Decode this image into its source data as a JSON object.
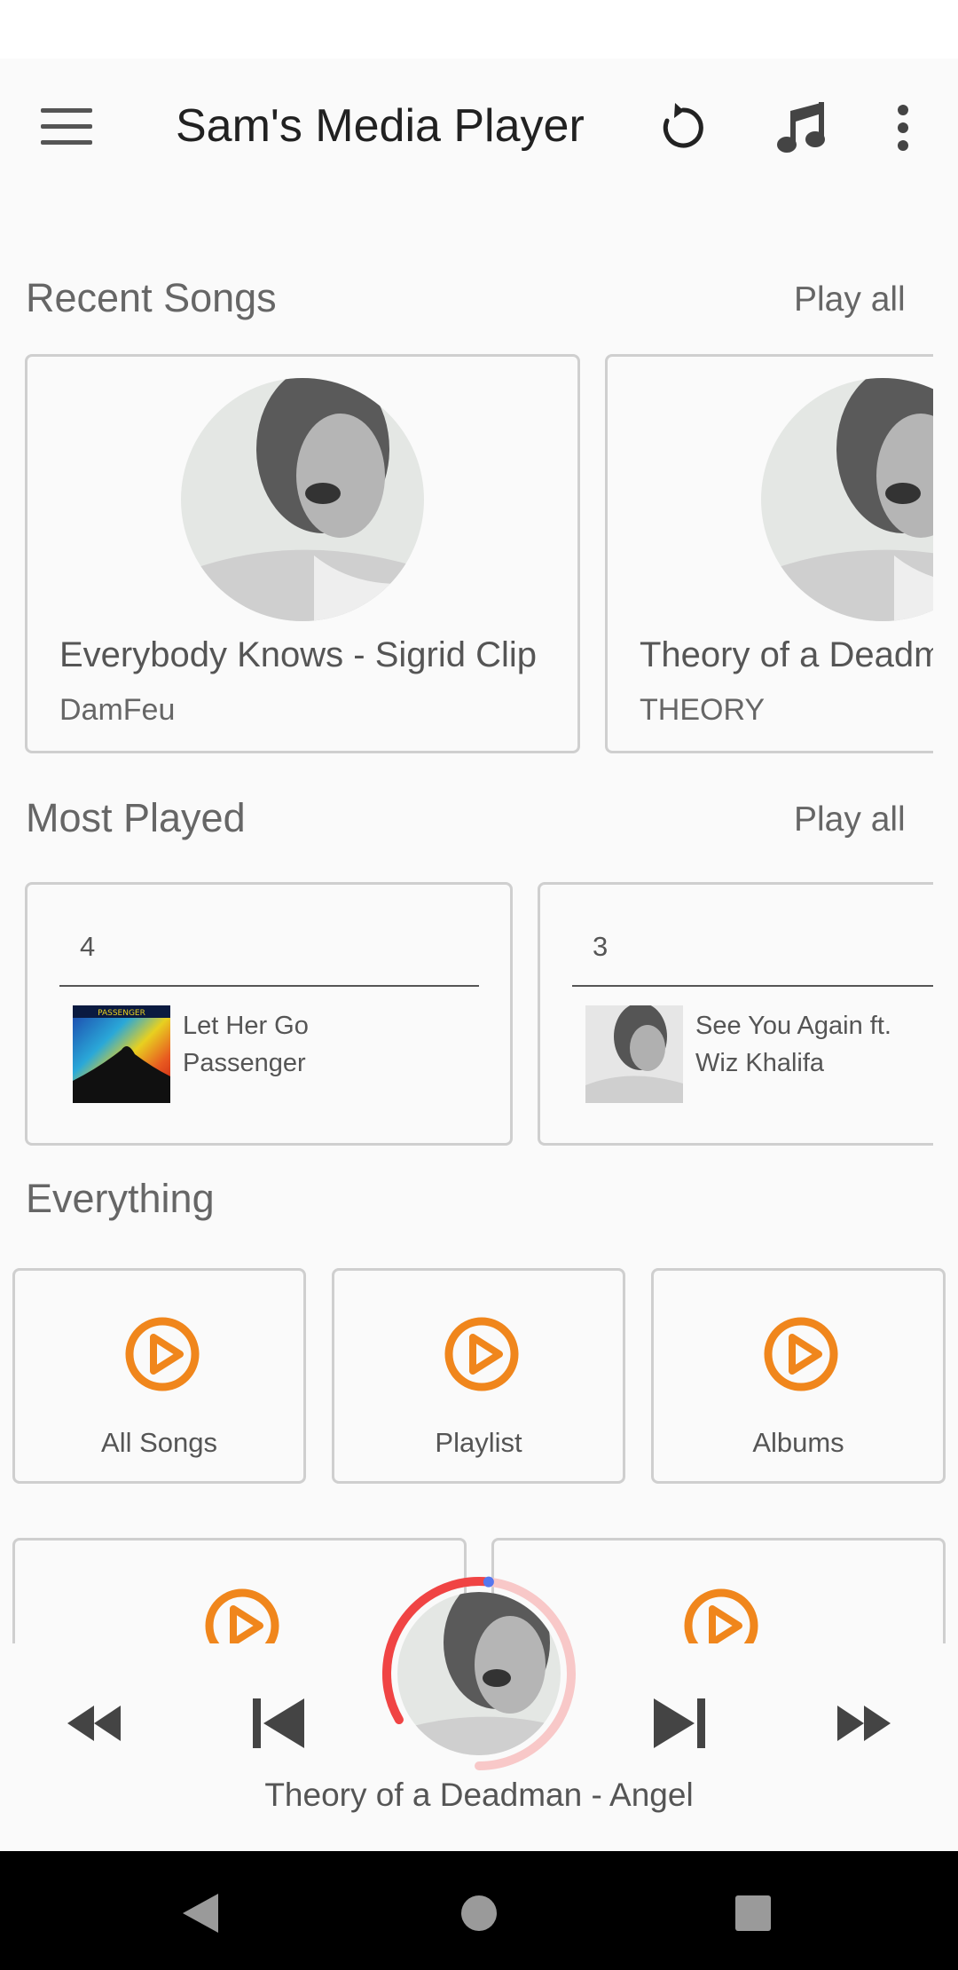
{
  "app": {
    "title": "Sam's Media Player"
  },
  "toolbar": {
    "menu_icon": "hamburger-menu-icon",
    "refresh_icon": "refresh-icon",
    "music_icon": "music-note-icon",
    "more_icon": "more-vertical-icon"
  },
  "recent": {
    "title": "Recent Songs",
    "play_all": "Play all",
    "items": [
      {
        "title": "Everybody Knows - Sigrid Clip",
        "artist": "DamFeu"
      },
      {
        "title": "Theory of a Deadman - Angel",
        "artist": "THEORY"
      }
    ]
  },
  "most_played": {
    "title": "Most Played",
    "play_all": "Play all",
    "items": [
      {
        "count": "4",
        "title": "Let Her Go",
        "artist": "Passenger"
      },
      {
        "count": "3",
        "title": "See You Again ft.",
        "artist": "Wiz Khalifa"
      }
    ]
  },
  "everything": {
    "title": "Everything",
    "categories": [
      {
        "label": "All Songs"
      },
      {
        "label": "Playlist"
      },
      {
        "label": "Albums"
      }
    ]
  },
  "player": {
    "now_playing": "Theory of a Deadman - Angel",
    "progress_fraction": 0.02
  },
  "colors": {
    "accent_orange": "#f0861c",
    "progress_red": "#f04444",
    "progress_track": "#f8c8c8",
    "progress_dot": "#5577ee"
  }
}
